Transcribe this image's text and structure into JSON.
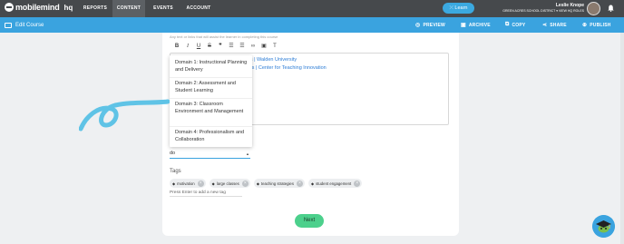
{
  "topnav": {
    "logo": "mobilemind",
    "logo_suffix": "hq",
    "items": [
      "REPORTS",
      "CONTENT",
      "EVENTS",
      "ACCOUNT"
    ],
    "learn_button": "Learn",
    "user_name": "Leslie Knope",
    "user_district": "GREEN ACRES SCHOOL DISTRICT",
    "view_hq_roles": "VIEW HQ ROLES"
  },
  "subnav": {
    "title": "Edit Course",
    "actions": [
      "PREVIEW",
      "ARCHIVE",
      "COPY",
      "SHARE",
      "PUBLISH"
    ]
  },
  "editor": {
    "helper_text": "Any text or links that will assist the learner in completing this course",
    "links": [
      "ses | Walden University",
      "rses | Center for Teaching Innovation"
    ]
  },
  "dropdown": {
    "options": [
      "Domain 1: Instructional Planning and Delivery",
      "Domain 2: Assessment and Student Learning",
      "Domain 3: Classroom Environment and Management",
      "Domain 4: Professionalism and Collaboration"
    ]
  },
  "search_value": "do",
  "tags": {
    "label": "Tags",
    "items": [
      "motivation",
      "large classes",
      "teaching strategies",
      "student engagement"
    ],
    "input_placeholder": "Press Enter to add a new tag"
  },
  "next_button": "Next",
  "colors": {
    "topnav": "#46494c",
    "subnav": "#3aa3df",
    "accent_green": "#4cd08c",
    "link": "#2d7dd6"
  }
}
